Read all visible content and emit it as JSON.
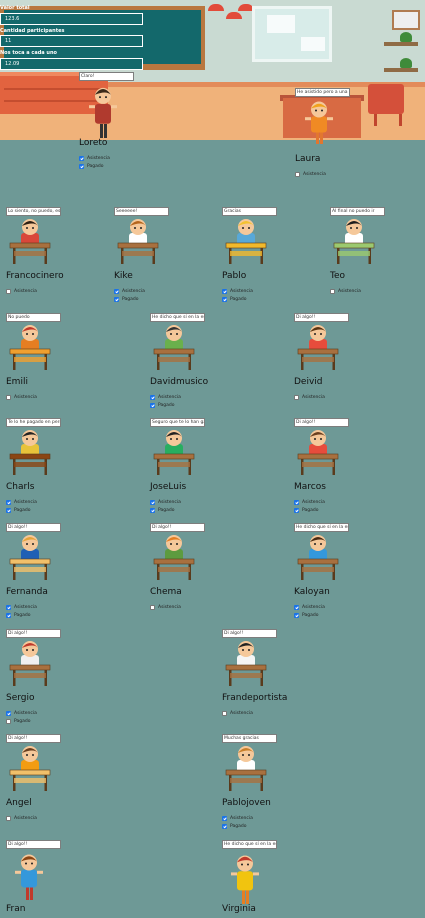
{
  "controls": {
    "total_label": "Valor total",
    "total_value": "123.6",
    "participants_label": "Cantidad participantes",
    "participants_value": "11",
    "per_person_label": "Nos toca a cada uno",
    "per_person_value": "12.09"
  },
  "checkbox_labels": {
    "attendance": "Asistencia",
    "paid": "Pagado"
  },
  "colors": {
    "background": "#6e9996",
    "board": "#13686b",
    "checked": "#1a73e8"
  },
  "students": [
    {
      "id": "loreto",
      "name": "Loreto",
      "bubble": "Claro!",
      "attendance": true,
      "paid": true,
      "show_paid": true
    },
    {
      "id": "laura",
      "name": "Laura",
      "bubble": "He asistido pero a una cg",
      "attendance": false,
      "paid": false,
      "show_paid": false
    },
    {
      "id": "francocinero",
      "name": "Francocinero",
      "bubble": "Lo siento, no puedo, estoy",
      "attendance": false,
      "paid": false,
      "show_paid": false
    },
    {
      "id": "kike",
      "name": "Kike",
      "bubble": "Seeeeee!",
      "attendance": true,
      "paid": true,
      "show_paid": true
    },
    {
      "id": "pablo",
      "name": "Pablo",
      "bubble": "Gracias",
      "attendance": true,
      "paid": true,
      "show_paid": true
    },
    {
      "id": "teo",
      "name": "Teo",
      "bubble": "Al final no puedo ir",
      "attendance": false,
      "paid": false,
      "show_paid": false
    },
    {
      "id": "emili",
      "name": "Emili",
      "bubble": "No puedo",
      "attendance": false,
      "paid": false,
      "show_paid": false
    },
    {
      "id": "davidmusico",
      "name": "Davidmusico",
      "bubble": "He dicho que sí en la esq",
      "attendance": true,
      "paid": true,
      "show_paid": true
    },
    {
      "id": "deivid",
      "name": "Deivid",
      "bubble": "Di algo!!",
      "attendance": false,
      "paid": false,
      "show_paid": false
    },
    {
      "id": "charls",
      "name": "Charls",
      "bubble": "Te lo he pagado en persona",
      "attendance": true,
      "paid": true,
      "show_paid": true
    },
    {
      "id": "joseluis",
      "name": "JoseLuis",
      "bubble": "Seguro que te lo han gast",
      "attendance": true,
      "paid": true,
      "show_paid": true
    },
    {
      "id": "marcos",
      "name": "Marcos",
      "bubble": "Di algo!!",
      "attendance": true,
      "paid": true,
      "show_paid": true
    },
    {
      "id": "fernanda",
      "name": "Fernanda",
      "bubble": "Di algo!!",
      "attendance": true,
      "paid": true,
      "show_paid": true
    },
    {
      "id": "chema",
      "name": "Chema",
      "bubble": "Di algo!!",
      "attendance": false,
      "paid": false,
      "show_paid": false
    },
    {
      "id": "kaloyan",
      "name": "Kaloyan",
      "bubble": "He dicho que sí en la esq",
      "attendance": true,
      "paid": true,
      "show_paid": true
    },
    {
      "id": "sergio",
      "name": "Sergio",
      "bubble": "Di algo!!",
      "attendance": true,
      "paid": false,
      "show_paid": true
    },
    {
      "id": "frandeportista",
      "name": "Frandeportista",
      "bubble": "Di algo!!",
      "attendance": false,
      "paid": false,
      "show_paid": false
    },
    {
      "id": "angel",
      "name": "Angel",
      "bubble": "Di algo!!",
      "attendance": false,
      "paid": false,
      "show_paid": false
    },
    {
      "id": "pablojoven",
      "name": "Pablojoven",
      "bubble": "Muchas gracias",
      "attendance": true,
      "paid": true,
      "show_paid": true
    },
    {
      "id": "fran",
      "name": "Fran",
      "bubble": "Di algo!!",
      "attendance": false,
      "paid": false,
      "show_paid": false
    },
    {
      "id": "virginia",
      "name": "Virginia",
      "bubble": "He dicho que sí en la esq",
      "attendance": false,
      "paid": false,
      "show_paid": false
    }
  ]
}
